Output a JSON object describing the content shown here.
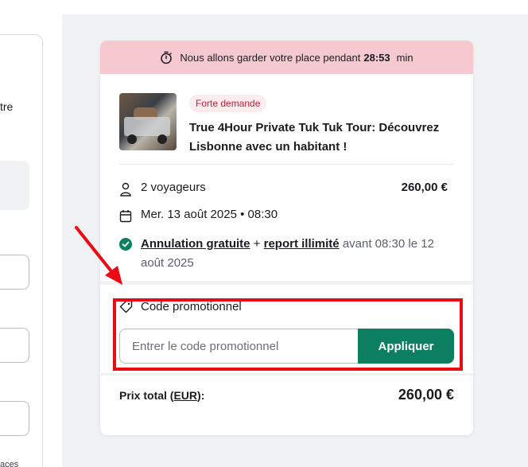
{
  "left": {
    "partial_text": "tre",
    "partial_footer": "aces"
  },
  "timer": {
    "text": "Nous allons garder votre place pendant",
    "time": "28:53",
    "unit": "min",
    "icon": "stopwatch-icon"
  },
  "product": {
    "badge": "Forte demande",
    "title": "True 4Hour Private Tuk Tuk Tour: Découvrez Lisbonne avec un habitant !",
    "image": "tuk-tuk-photo"
  },
  "details": {
    "travelers": "2 voyageurs",
    "price": "260,00 €",
    "date": "Mer. 13 août 2025 • 08:30",
    "cancel_free": "Annulation gratuite",
    "cancel_plus": "+",
    "cancel_report": "report illimité",
    "cancel_rest": "avant 08:30 le 12 août 2025"
  },
  "promo": {
    "label": "Code promotionnel",
    "placeholder": "Entrer le code promotionnel",
    "button": "Appliquer"
  },
  "total": {
    "label_prefix": "Prix total (",
    "currency": "EUR",
    "label_suffix": "):",
    "value": "260,00 €"
  },
  "colors": {
    "timer_bg": "#f6c8d0",
    "accent_green": "#0b7f5f",
    "badge_red": "#c2203a",
    "annotation_red": "#ec0b14"
  }
}
